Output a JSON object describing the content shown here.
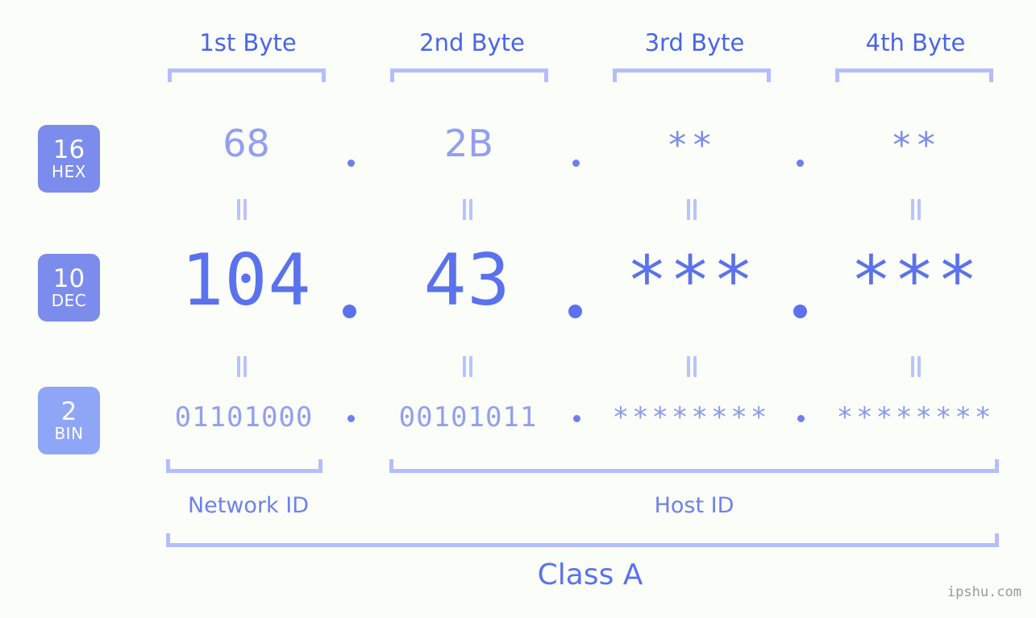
{
  "watermark": "ipshu.com",
  "byte_headers": [
    {
      "label": "1st Byte"
    },
    {
      "label": "2nd Byte"
    },
    {
      "label": "3rd Byte"
    },
    {
      "label": "4th Byte"
    }
  ],
  "rows": [
    {
      "id": "hex",
      "badge_base": "16",
      "badge_name": "HEX",
      "badge_color": "#7b8cec",
      "values": [
        "68",
        "2B",
        "**",
        "**"
      ],
      "separator": "."
    },
    {
      "id": "dec",
      "badge_base": "10",
      "badge_name": "DEC",
      "badge_color": "#7b8cec",
      "values": [
        "104",
        "43",
        "***",
        "***"
      ],
      "separator": "."
    },
    {
      "id": "bin",
      "badge_base": "2",
      "badge_name": "BIN",
      "badge_color": "#8fa5f5",
      "values": [
        "01101000",
        "00101011",
        "********",
        "********"
      ],
      "separator": "."
    }
  ],
  "connectors": {
    "symbol": "=",
    "count_per_row": 4
  },
  "sections": {
    "network_id": "Network ID",
    "host_id": "Host ID",
    "class": "Class A"
  },
  "colors": {
    "background": "#fbfdf8",
    "bracket": "#b3beff",
    "hex_text": "#929fef",
    "dec_text": "#5a72ed",
    "bin_text": "#929fef",
    "header_text": "#4865ec",
    "badge_text": "#ffffff",
    "watermark_text": "#9a9a9a"
  }
}
